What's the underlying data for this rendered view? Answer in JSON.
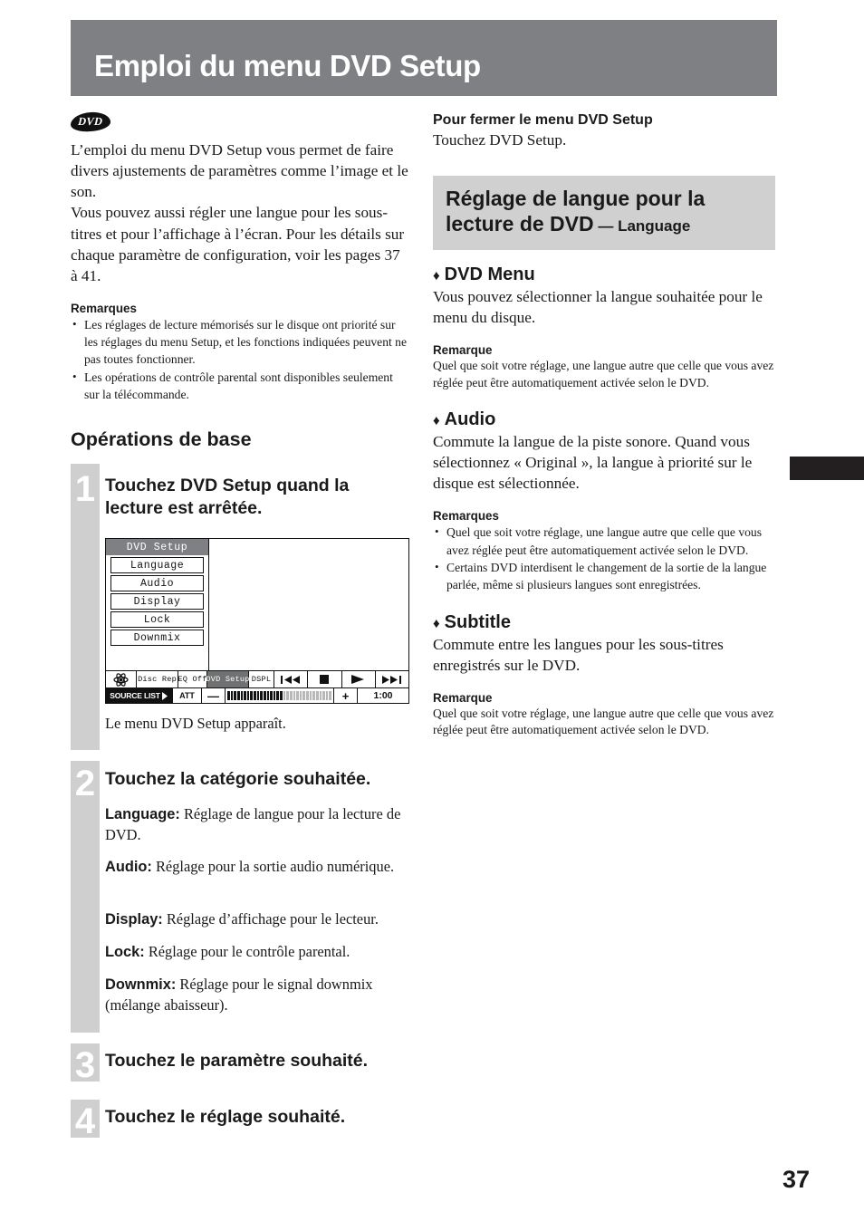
{
  "page": {
    "title": "Emploi du menu DVD Setup",
    "number": "37",
    "accent_gray": "#7e8083",
    "section_gray": "#d0d0d0",
    "step_band_gray": "#cfcfcf",
    "edge_tab_color": "#231f20"
  },
  "left": {
    "disc_badge": "DVD",
    "intro": "L’emploi du menu DVD Setup vous permet de faire divers ajustements de paramètres comme l’image et le son.\nVous pouvez aussi régler une langue pour les sous-titres et pour l’affichage à l’écran. Pour les détails sur chaque paramètre de configuration, voir les pages 37 à 41.",
    "intro_p1": "L’emploi du menu DVD Setup vous permet de faire divers ajustements de paramètres comme l’image et le son.",
    "intro_p2": "Vous pouvez aussi régler une langue pour les sous-titres et pour l’affichage à l’écran. Pour les détails sur chaque paramètre de configuration, voir les pages 37 à 41.",
    "notes_heading": "Remarques",
    "notes": [
      "Les réglages de lecture mémorisés sur le disque ont priorité sur les réglages du menu Setup, et les fonctions indiquées peuvent ne pas toutes fonctionner.",
      "Les opérations de contrôle parental sont disponibles seulement sur la télécommande."
    ],
    "ops_heading": "Opérations de base",
    "steps": [
      {
        "number": "1",
        "title": "Touchez DVD Setup quand la lecture est arrêtée.",
        "caption": "Le menu DVD Setup apparaît."
      },
      {
        "number": "2",
        "title": "Touchez la catégorie souhaitée.",
        "items": [
          {
            "term": "Language:",
            "desc": " Réglage de langue pour la lecture de DVD."
          },
          {
            "term": "Audio:",
            "desc": " Réglage pour la sortie audio numérique."
          },
          {
            "term": "Display:",
            "desc": " Réglage d’affichage pour le lecteur."
          },
          {
            "term": "Lock:",
            "desc": " Réglage pour le contrôle parental."
          },
          {
            "term": "Downmix:",
            "desc": " Réglage pour le signal downmix (mélange abaisseur)."
          }
        ]
      },
      {
        "number": "3",
        "title": "Touchez le paramètre souhaité."
      },
      {
        "number": "4",
        "title": "Touchez le réglage souhaité."
      }
    ]
  },
  "device_screen": {
    "menu_title": "DVD Setup",
    "menu_items": [
      "Language",
      "Audio",
      "Display",
      "Lock",
      "Downmix"
    ],
    "toolbar": {
      "source_icon": "atom-icon",
      "disc_rep": "Disc Rep",
      "eq": "EQ Off",
      "dvd_setup": "DVD Setup",
      "dspl": "DSPL",
      "prev": "◀◀",
      "stop": "■",
      "play": "▶",
      "next": "▶▶"
    },
    "bottom_bar": {
      "source_list": "SOURCE LIST",
      "att": "ATT",
      "minus": "—",
      "plus": "+",
      "time": "1:00",
      "volume_total": 32,
      "volume_filled": 17
    }
  },
  "right": {
    "close_heading": "Pour fermer le menu DVD Setup",
    "close_text": "Touchez DVD Setup.",
    "section": {
      "title_main": "Réglage de langue pour la lecture de DVD",
      "title_dash": " — ",
      "title_sub": "Language",
      "title_line1": "Réglage de langue pour la",
      "title_line2": "lecture de DVD"
    },
    "subsections": [
      {
        "diamond": "♦",
        "heading": "DVD Menu",
        "body": "Vous pouvez sélectionner la langue souhaitée pour le menu du disque.",
        "notes_heading": "Remarque",
        "note_text": "Quel que soit votre réglage, une langue autre que celle que vous avez réglée peut être automatiquement activée selon le DVD."
      },
      {
        "diamond": "♦",
        "heading": "Audio",
        "body": "Commute la langue de la piste sonore. Quand vous sélectionnez « Original », la langue à priorité sur le disque est sélectionnée.",
        "notes_heading": "Remarques",
        "notes": [
          "Quel que soit votre réglage, une langue autre que celle que vous avez réglée peut être automatiquement activée selon le DVD.",
          "Certains DVD interdisent le changement de la sortie de la langue parlée, même si plusieurs langues sont enregistrées."
        ]
      },
      {
        "diamond": "♦",
        "heading": "Subtitle",
        "body": "Commute entre les langues pour les sous-titres enregistrés sur le DVD.",
        "notes_heading": "Remarque",
        "note_text": "Quel que soit votre réglage, une langue autre que celle que vous avez réglée peut être automatiquement activée selon le DVD."
      }
    ]
  }
}
